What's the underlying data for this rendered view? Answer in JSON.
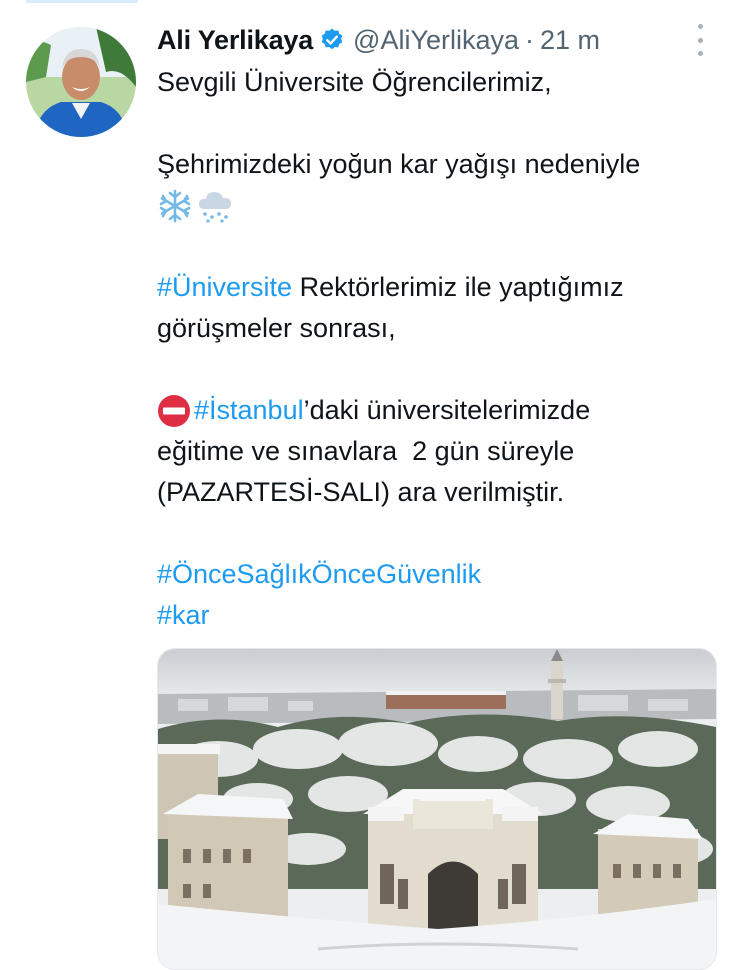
{
  "tweet": {
    "display_name": "Ali Yerlikaya",
    "handle": "@AliYerlikaya",
    "separator": "·",
    "time": "21 m",
    "lines": {
      "greeting": "Sevgili Üniversite Öğrencilerimiz,",
      "snow_line": "Şehrimizdeki yoğun kar yağışı nedeniyle",
      "hashtag_universite": "#Üniversite",
      "universite_rest": " Rektörlerimiz ile yaptığımız",
      "meetings": "görüşmeler sonrası,",
      "hashtag_istanbul": "#İstanbul",
      "istanbul_rest": "’daki üniversitelerimizde",
      "exams": "eğitime ve sınavlara  2 gün süreyle",
      "days": "(PAZARTESİ-SALI) ara verilmiştir.",
      "hashtag_health": "#ÖnceSağlıkÖnceGüvenlik",
      "hashtag_kar": "#kar"
    },
    "icons": {
      "verified": "verified-badge-icon",
      "snowflake": "snowflake-icon",
      "snow_cloud": "snow-cloud-icon",
      "no_entry": "no-entry-icon",
      "more": "more-options-icon"
    },
    "media": {
      "description": "snowy-campus-aerial-photo"
    }
  },
  "colors": {
    "link": "#1d9bf0",
    "text": "#0f1419",
    "secondary": "#536471",
    "verified": "#1d9bf0",
    "no_entry": "#dd2e44"
  }
}
